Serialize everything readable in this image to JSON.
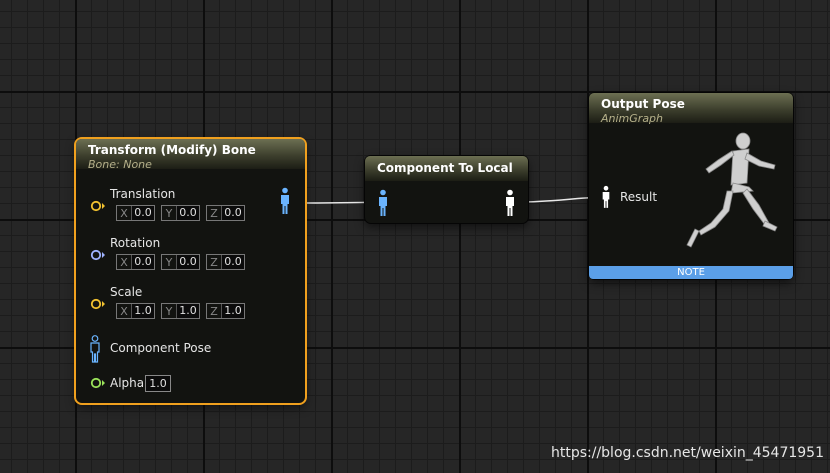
{
  "nodes": {
    "transform": {
      "title": "Transform (Modify) Bone",
      "subtitle": "Bone: None",
      "translation": {
        "label": "Translation",
        "x_axis": "X",
        "x": "0.0",
        "y_axis": "Y",
        "y": "0.0",
        "z_axis": "Z",
        "z": "0.0"
      },
      "rotation": {
        "label": "Rotation",
        "x_axis": "X",
        "x": "0.0",
        "y_axis": "Y",
        "y": "0.0",
        "z_axis": "Z",
        "z": "0.0"
      },
      "scale": {
        "label": "Scale",
        "x_axis": "X",
        "x": "1.0",
        "y_axis": "Y",
        "y": "1.0",
        "z_axis": "Z",
        "z": "1.0"
      },
      "component_pose_label": "Component Pose",
      "alpha": {
        "label": "Alpha",
        "value": "1.0"
      }
    },
    "component_to_local": {
      "title": "Component To Local"
    },
    "output_pose": {
      "title": "Output Pose",
      "subtitle": "AnimGraph",
      "result_label": "Result",
      "note_label": "NOTE"
    }
  },
  "watermark": "https://blog.csdn.net/weixin_45471951",
  "colors": {
    "selection_border": "#f0a01e",
    "vector_pin": "#f2c230",
    "rotator_pin": "#a0b3ff",
    "float_pin": "#9be35a",
    "component_pose_pin": "#6ab4ff",
    "local_pose_pin": "#ffffff",
    "note_bar": "#5b9fe8"
  },
  "icons": {
    "vector_pin": "pin-circle-icon",
    "pose_pin": "pose-figure-icon",
    "preview": "mannequin-icon"
  }
}
